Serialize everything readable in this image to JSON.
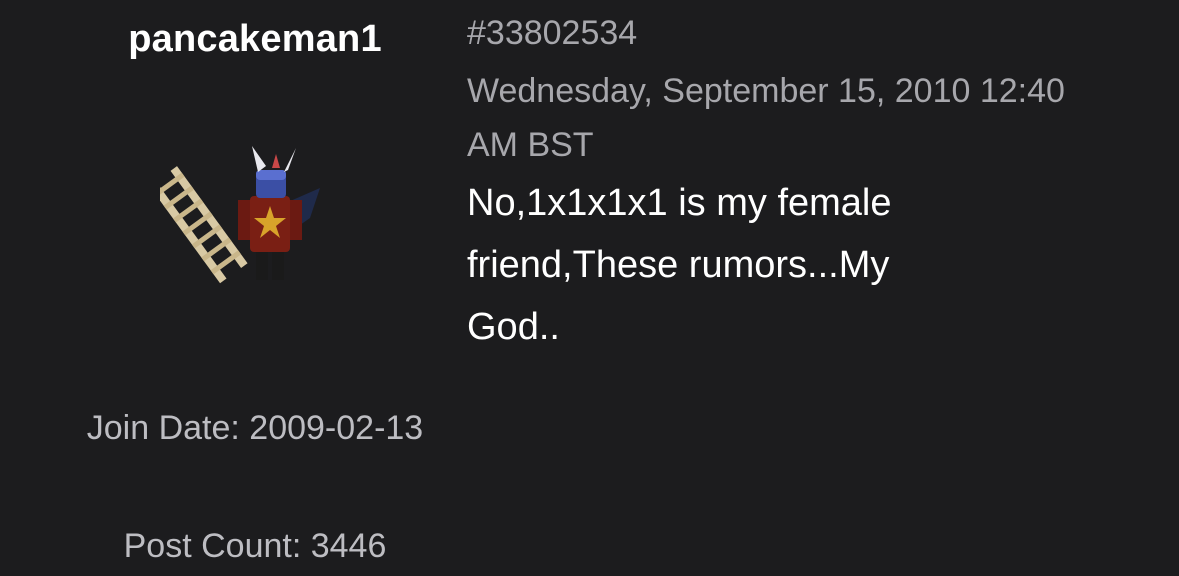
{
  "author": {
    "username": "pancakeman1",
    "avatar_icon": "roblox-avatar-with-ladder-icon",
    "join_date": "Join Date: 2009-02-13",
    "post_count": "Post Count: 3446"
  },
  "post": {
    "id": "#33802534",
    "date": "Wednesday, September 15, 2010 12:40 AM BST",
    "body": "No,1x1x1x1 is my female friend,These rumors...My God.."
  },
  "colors": {
    "background": "#1c1c1e",
    "primary_text": "#ffffff",
    "secondary_text": "#a7a7ac"
  }
}
